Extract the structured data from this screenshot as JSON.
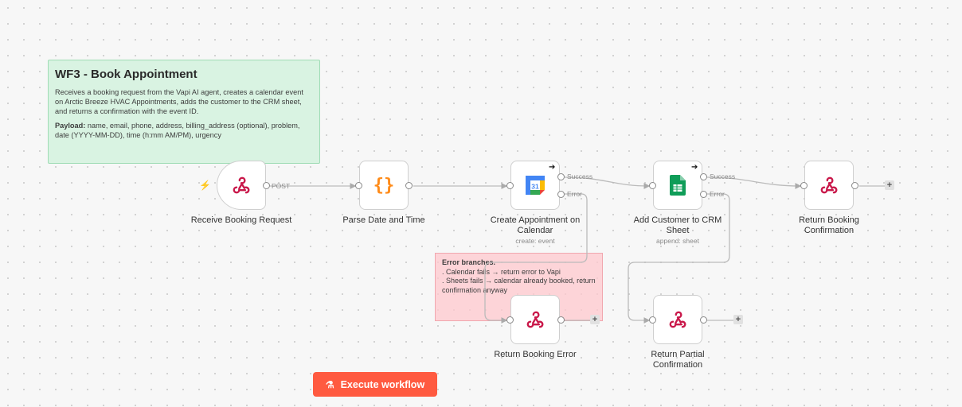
{
  "sticky_note": {
    "title": "WF3 - Book Appointment",
    "description": "Receives a booking request from the Vapi AI agent, creates a calendar event on Arctic Breeze HVAC Appointments, adds the customer to the CRM sheet, and returns a confirmation with the event ID.",
    "payload_label": "Payload:",
    "payload_text": " name, email, phone, address, billing_address (optional), problem, date (YYYY-MM-DD), time (h:mm AM/PM), urgency"
  },
  "error_note": {
    "title": "Error branches.",
    "line1": ". Calendar fails → return error to Vapi",
    "line2": ". Sheets fails → calendar already booked, return confirmation anyway"
  },
  "nodes": {
    "receive": {
      "label": "Receive Booking Request",
      "output_tag": "POST",
      "icon": "webhook-icon"
    },
    "parse": {
      "label": "Parse Date and Time",
      "icon": "braces-icon"
    },
    "calendar": {
      "label": "Create Appointment on Calendar",
      "sub": "create: event",
      "success": "Success",
      "error": "Error",
      "icon": "google-calendar-icon",
      "icon_text": "31"
    },
    "crm": {
      "label": "Add Customer to CRM Sheet",
      "sub": "append: sheet",
      "success": "Success",
      "error": "Error",
      "icon": "google-sheets-icon"
    },
    "return_confirm": {
      "label": "Return Booking Confirmation",
      "icon": "webhook-icon"
    },
    "return_error": {
      "label": "Return Booking Error",
      "icon": "webhook-icon"
    },
    "return_partial": {
      "label": "Return Partial Confirmation",
      "icon": "webhook-icon"
    }
  },
  "add_symbol": "+",
  "execute_button": {
    "label": "Execute workflow",
    "icon": "flask-icon"
  },
  "colors": {
    "accent": "#ff5a40",
    "sticky_green": "#d9f3e2",
    "sticky_red": "#ffc8cd",
    "webhook_pink": "#c9184a"
  }
}
